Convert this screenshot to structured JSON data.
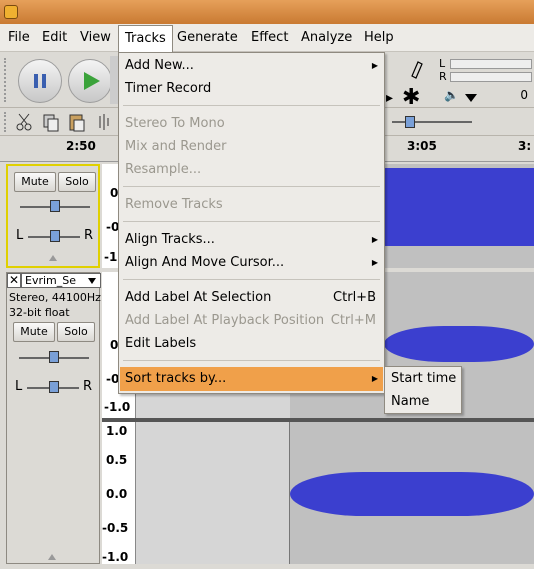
{
  "menubar": {
    "items": [
      {
        "label": "File"
      },
      {
        "label": "Edit"
      },
      {
        "label": "View"
      },
      {
        "label": "Tracks"
      },
      {
        "label": "Generate"
      },
      {
        "label": "Effect"
      },
      {
        "label": "Analyze"
      },
      {
        "label": "Help"
      }
    ]
  },
  "ruler": {
    "labels": [
      "2:50",
      "3:05",
      "3:"
    ]
  },
  "meter": {
    "left_label": "L",
    "right_label": "R",
    "volume_value": "0"
  },
  "track1": {
    "mute_label": "Mute",
    "solo_label": "Solo",
    "pan_left": "L",
    "pan_right": "R",
    "scale": [
      "0",
      "-0",
      "-1."
    ]
  },
  "track2": {
    "name": "Evrim_Se",
    "info_line1": "Stereo, 44100Hz",
    "info_line2": "32-bit float",
    "mute_label": "Mute",
    "solo_label": "Solo",
    "pan_left": "L",
    "pan_right": "R",
    "scale_top": [
      "0",
      "-0",
      "-1.0"
    ],
    "scale_bottom": [
      "1.0",
      "0.5",
      "0.0",
      "-0.5",
      "-1.0"
    ]
  },
  "tracks_menu": {
    "items": [
      {
        "label": "Add New...",
        "enabled": true,
        "submenu": true
      },
      {
        "label": "Timer Record",
        "enabled": true
      },
      {
        "label": "Stereo To Mono",
        "enabled": false
      },
      {
        "label": "Mix and Render",
        "enabled": false
      },
      {
        "label": "Resample...",
        "enabled": false
      },
      {
        "label": "Remove Tracks",
        "enabled": false
      },
      {
        "label": "Align Tracks...",
        "enabled": true,
        "submenu": true
      },
      {
        "label": "Align And Move Cursor...",
        "enabled": true,
        "submenu": true
      },
      {
        "label": "Add Label At Selection",
        "enabled": true,
        "shortcut": "Ctrl+B"
      },
      {
        "label": "Add Label At Playback Position",
        "enabled": false,
        "shortcut": "Ctrl+M"
      },
      {
        "label": "Edit Labels",
        "enabled": true
      },
      {
        "label": "Sort tracks by...",
        "enabled": true,
        "submenu": true,
        "highlighted": true
      }
    ]
  },
  "sort_submenu": {
    "items": [
      {
        "label": "Start time"
      },
      {
        "label": "Name"
      }
    ]
  },
  "colors": {
    "menu_highlight": "#f0a04a",
    "waveform": "#3b3fcf",
    "titlebar": "#d88a40"
  }
}
